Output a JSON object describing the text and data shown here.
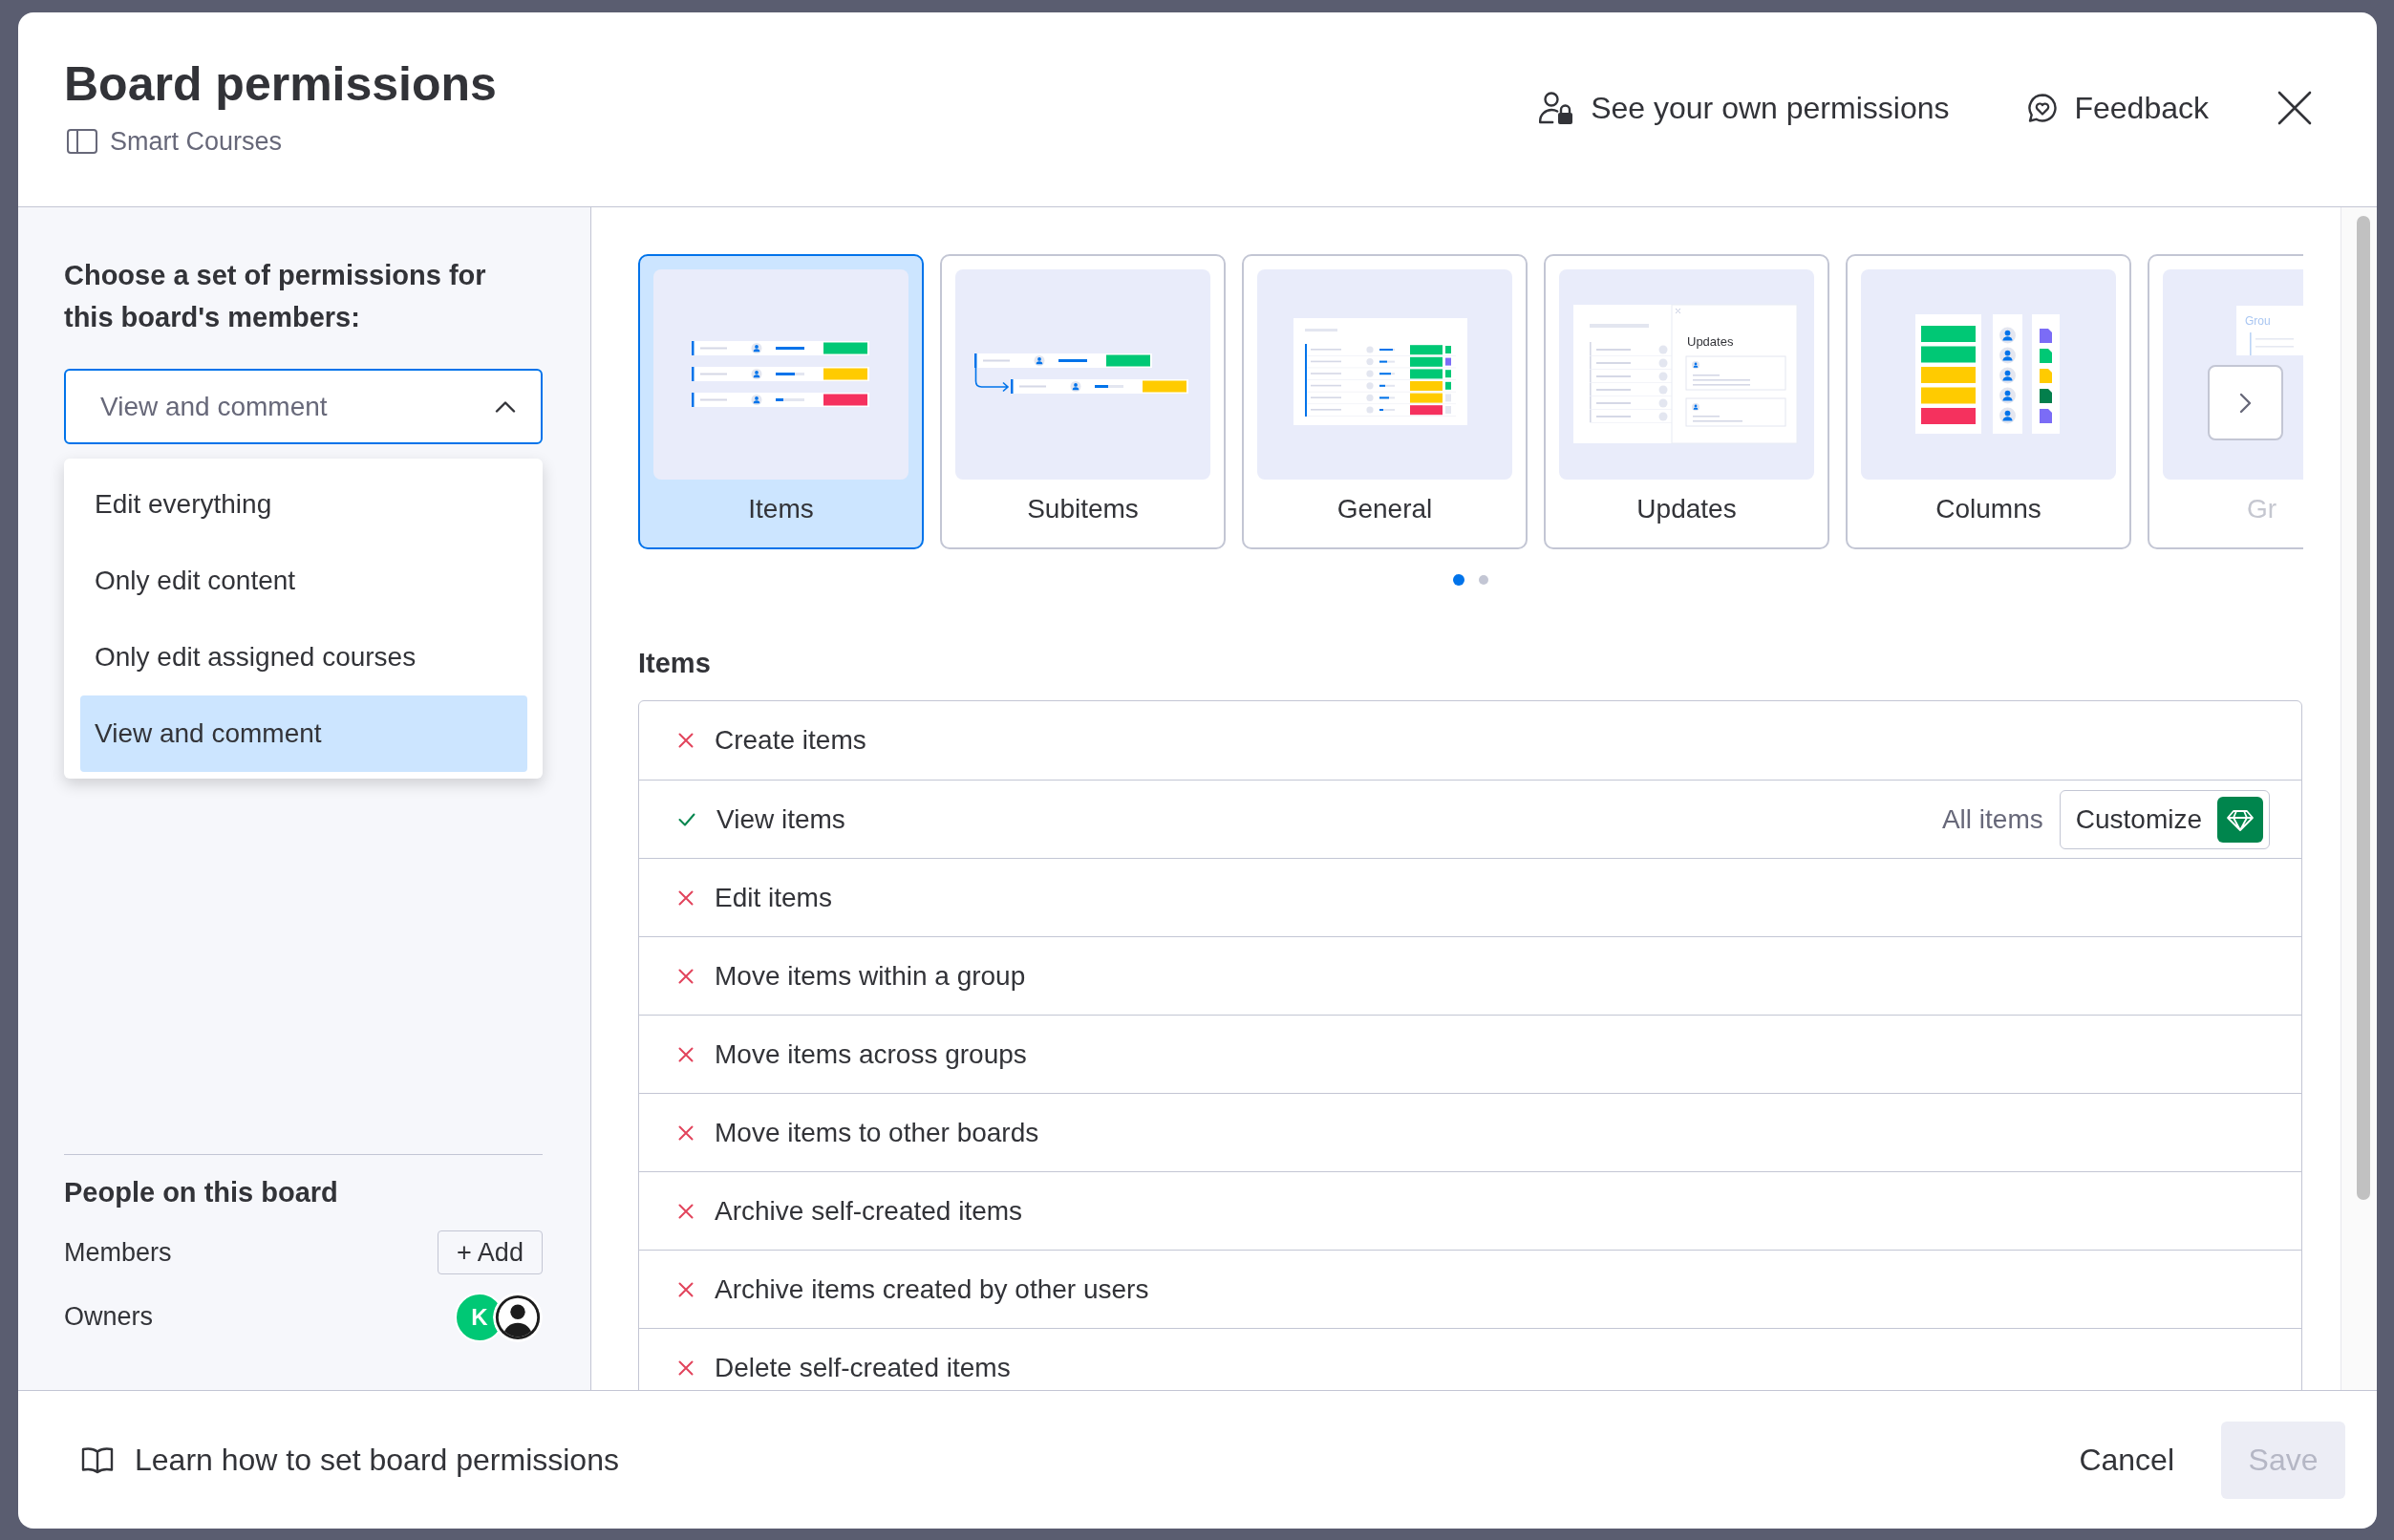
{
  "dialog": {
    "title": "Board permissions",
    "board_name": "Smart Courses"
  },
  "header_actions": [
    {
      "kind": "own_permissions",
      "label": "See your own permissions"
    },
    {
      "kind": "feedback",
      "label": "Feedback"
    }
  ],
  "permission_set": {
    "heading": "Choose a set of permissions for this board's members:",
    "value": "View and comment",
    "expanded": true,
    "options": [
      {
        "label": "Edit everything",
        "selected": false
      },
      {
        "label": "Only edit content",
        "selected": false
      },
      {
        "label": "Only edit assigned courses",
        "selected": false
      },
      {
        "label": "View and comment",
        "selected": true
      }
    ]
  },
  "people": {
    "heading": "People on this board",
    "members_label": "Members",
    "add_button": "+ Add",
    "owners_label": "Owners",
    "owners": [
      {
        "kind": "initials",
        "initials": "K"
      },
      {
        "kind": "default"
      }
    ]
  },
  "categories": [
    {
      "label": "Items",
      "kind": "items",
      "selected": true,
      "faded": false
    },
    {
      "label": "Subitems",
      "kind": "subitems",
      "selected": false,
      "faded": false
    },
    {
      "label": "General",
      "kind": "general",
      "selected": false,
      "faded": false
    },
    {
      "label": "Updates",
      "kind": "updates",
      "selected": false,
      "faded": false,
      "thumb_text": "Updates"
    },
    {
      "label": "Columns",
      "kind": "columns",
      "selected": false,
      "faded": false
    },
    {
      "label": "Gr",
      "kind": "groups",
      "selected": false,
      "faded": true,
      "thumb_text": "Grou"
    }
  ],
  "page_dots": [
    {
      "selected": true
    },
    {
      "selected": false
    }
  ],
  "section": {
    "title": "Items",
    "permissions": [
      {
        "label": "Create items",
        "allowed": false
      },
      {
        "label": "View items",
        "allowed": true,
        "scope": "All items",
        "action": "Customize"
      },
      {
        "label": "Edit items",
        "allowed": false
      },
      {
        "label": "Move items within a group",
        "allowed": false
      },
      {
        "label": "Move items across groups",
        "allowed": false
      },
      {
        "label": "Move items to other boards",
        "allowed": false
      },
      {
        "label": "Archive self-created items",
        "allowed": false
      },
      {
        "label": "Archive items created by other users",
        "allowed": false
      },
      {
        "label": "Delete self-created items",
        "allowed": false
      }
    ]
  },
  "footer": {
    "help_link": "Learn how to set board permissions",
    "buttons": [
      {
        "label": "Cancel",
        "kind": "link",
        "disabled": false
      },
      {
        "label": "Save",
        "kind": "primary",
        "disabled": true
      }
    ]
  }
}
